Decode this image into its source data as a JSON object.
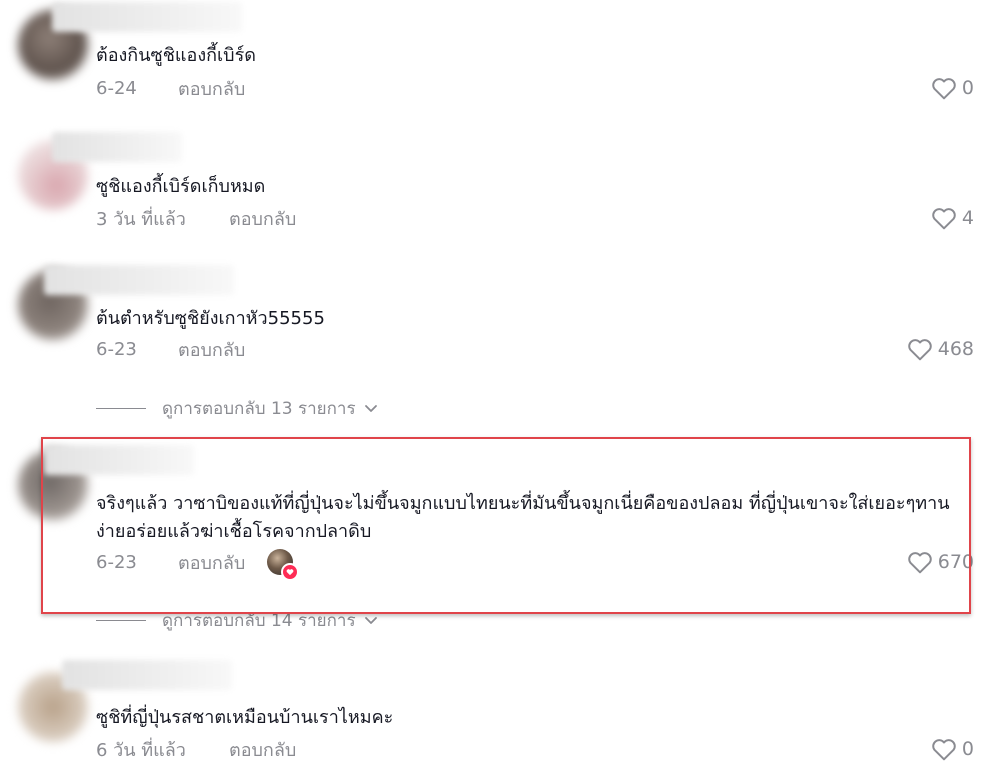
{
  "comments": [
    {
      "text": "ต้องกินซูชิแองกี้เบิร์ด",
      "date": "6-24",
      "reply": "ตอบกลับ",
      "likes": "0"
    },
    {
      "text": "ซูชิแองกี้เบิร์ดเก็บหมด",
      "date": "3 วัน ที่แล้ว",
      "reply": "ตอบกลับ",
      "likes": "4"
    },
    {
      "text": "ต้นตำหรับซูชิยังเกาหัว55555",
      "date": "6-23",
      "reply": "ตอบกลับ",
      "likes": "468",
      "view_replies": "ดูการตอบกลับ 13 รายการ"
    },
    {
      "text": "จริงๆแล้ว วาซาบิของแท้ที่ญี่ปุ่นจะไม่ขึ้นจมูกแบบไทยนะที่มันขึ้นจมูกเนี่ยคือของปลอม ที่ญี่ปุ่นเขาจะใส่เยอะๆทานง่ายอร่อยแล้วฆ่าเชื้อโรคจากปลาดิบ",
      "date": "6-23",
      "reply": "ตอบกลับ",
      "likes": "670",
      "view_replies": "ดูการตอบกลับ 14 รายการ"
    },
    {
      "text": "ซูชิที่ญี่ปุ่นรสชาตเหมือนบ้านเราไหมคะ",
      "date": "6 วัน ที่แล้ว",
      "reply": "ตอบกลับ",
      "likes": "0"
    }
  ],
  "icons": {
    "like": "heart-outline-icon",
    "expand": "chevron-down-icon",
    "creator_liked": "heart-badge-icon"
  },
  "colors": {
    "text": "#161823",
    "muted": "#8a8b91",
    "highlight": "#e0444a",
    "like_badge": "#fe2c55"
  }
}
